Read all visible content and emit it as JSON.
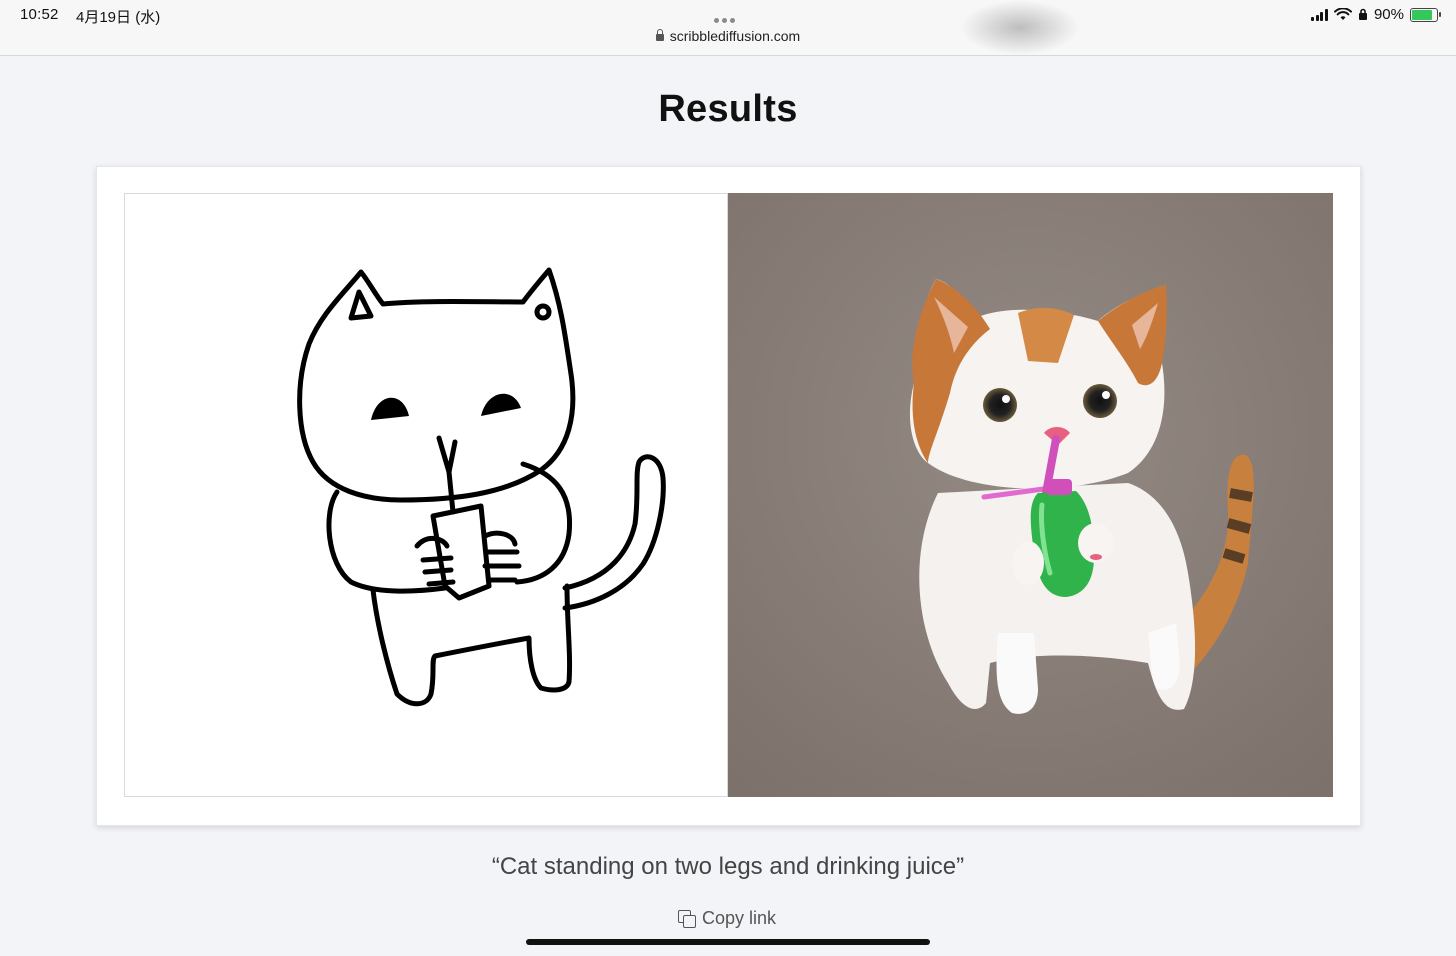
{
  "status_bar": {
    "time": "10:52",
    "date": "4月19日 (水)",
    "url": "scribblediffusion.com",
    "battery": "90%",
    "battery_level": 0.9
  },
  "page": {
    "title": "Results",
    "prompt": "“Cat standing on two legs and drinking juice”",
    "copy_link_label": "Copy link"
  },
  "icons": [
    "lock-icon",
    "signal-icon",
    "wifi-icon",
    "battery-icon",
    "copy-icon"
  ],
  "colors": {
    "background": "#f2f4f7",
    "card": "#ffffff",
    "battery_green": "#34c759"
  }
}
